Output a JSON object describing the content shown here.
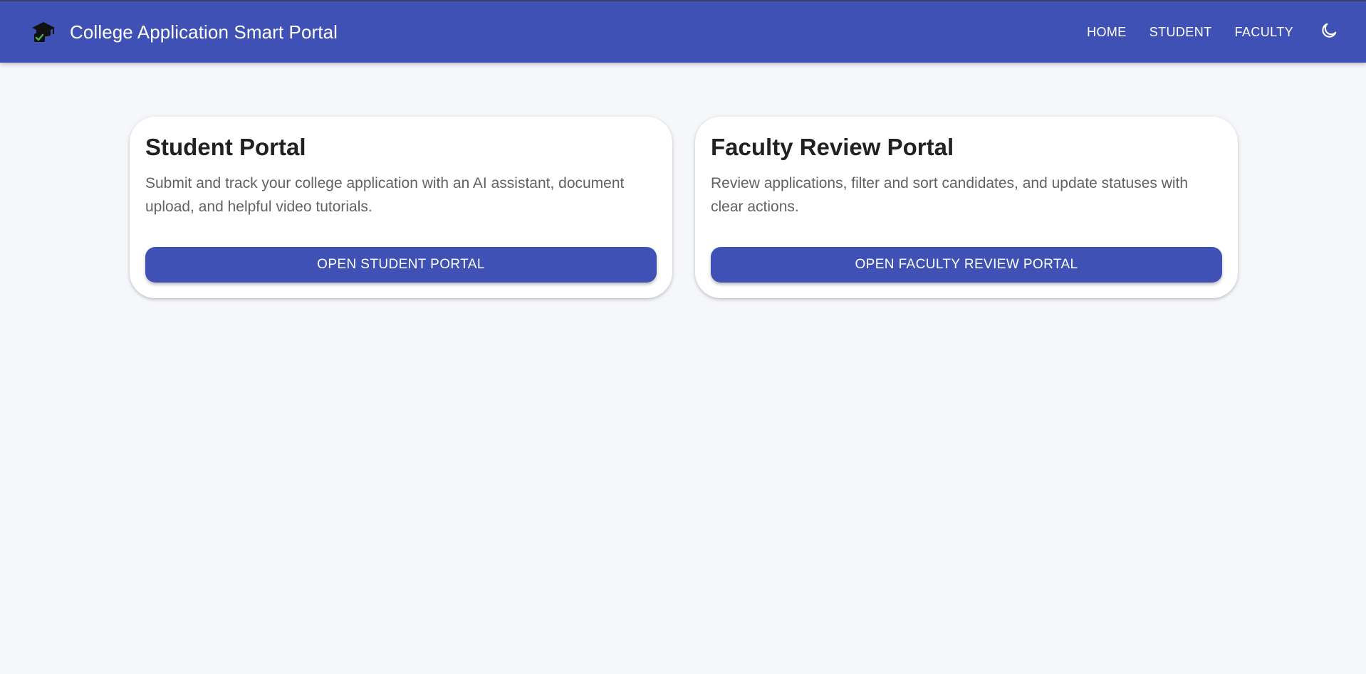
{
  "app": {
    "title": "College Application Smart Portal",
    "brand_icon": "graduation-cap-check-icon"
  },
  "nav": {
    "items": [
      {
        "label": "HOME"
      },
      {
        "label": "STUDENT"
      },
      {
        "label": "FACULTY"
      }
    ],
    "theme_toggle_icon": "moon-icon"
  },
  "cards": [
    {
      "title": "Student Portal",
      "description": "Submit and track your college application with an AI assistant, document upload, and helpful video tutorials.",
      "button_label": "OPEN STUDENT PORTAL"
    },
    {
      "title": "Faculty Review Portal",
      "description": "Review applications, filter and sort candidates, and update statuses with clear actions.",
      "button_label": "OPEN FACULTY REVIEW PORTAL"
    }
  ],
  "colors": {
    "primary": "#3f51b5",
    "background": "#f6f7fb",
    "card": "#ffffff",
    "heading": "#212121",
    "body_text": "#5f6368",
    "icon_accent": "#2e7d32"
  }
}
